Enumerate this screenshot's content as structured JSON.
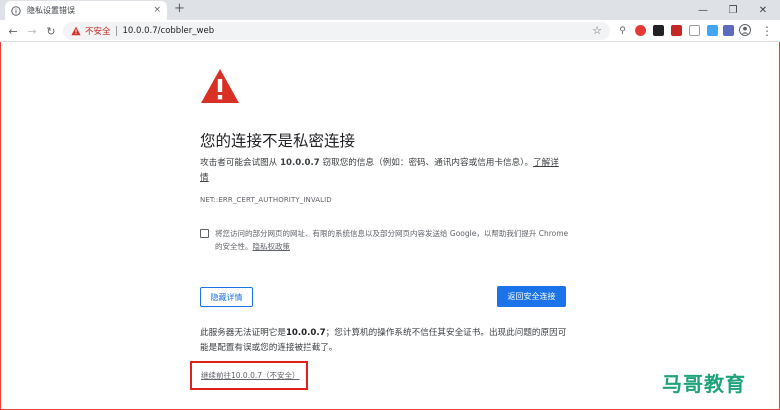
{
  "tab": {
    "title": "隐私设置错误",
    "close": "×"
  },
  "window": {
    "newtab": "+",
    "minimize": "—",
    "restore": "❐",
    "close": "✕"
  },
  "toolbar": {
    "back": "←",
    "forward": "→",
    "reload": "↻",
    "insecure_label": "不安全",
    "url": "10.0.0.7/cobbler_web",
    "star": "☆",
    "menu": "⋮"
  },
  "page": {
    "heading": "您的连接不是私密连接",
    "desc_prefix": "攻击者可能会试图从 ",
    "desc_host": "10.0.0.7",
    "desc_suffix": " 窃取您的信息（例如：密码、通讯内容或信用卡信息）。",
    "learn_more": "了解详情",
    "error_code": "NET::ERR_CERT_AUTHORITY_INVALID",
    "optin_text": "将您访问的部分网页的网址、有限的系统信息以及部分网页内容发送给 Google，以帮助我们提升 Chrome 的安全性。",
    "privacy_policy": "隐私权政策",
    "details_button": "隐藏详情",
    "back_button": "返回安全连接",
    "details_p1": "此服务器无法证明它是",
    "details_host": "10.0.0.7",
    "details_p2": "；您计算机的操作系统不信任其安全证书。出现此问题的原因可能是配置有误或您的连接被拦截了。",
    "proceed_link": "继续前往10.0.0.7（不安全）"
  },
  "watermark": "马哥教育",
  "colors": {
    "accent": "#1a73e8",
    "danger": "#d93025",
    "highlight_box": "#e0201a",
    "watermark": "#1fa37a"
  }
}
